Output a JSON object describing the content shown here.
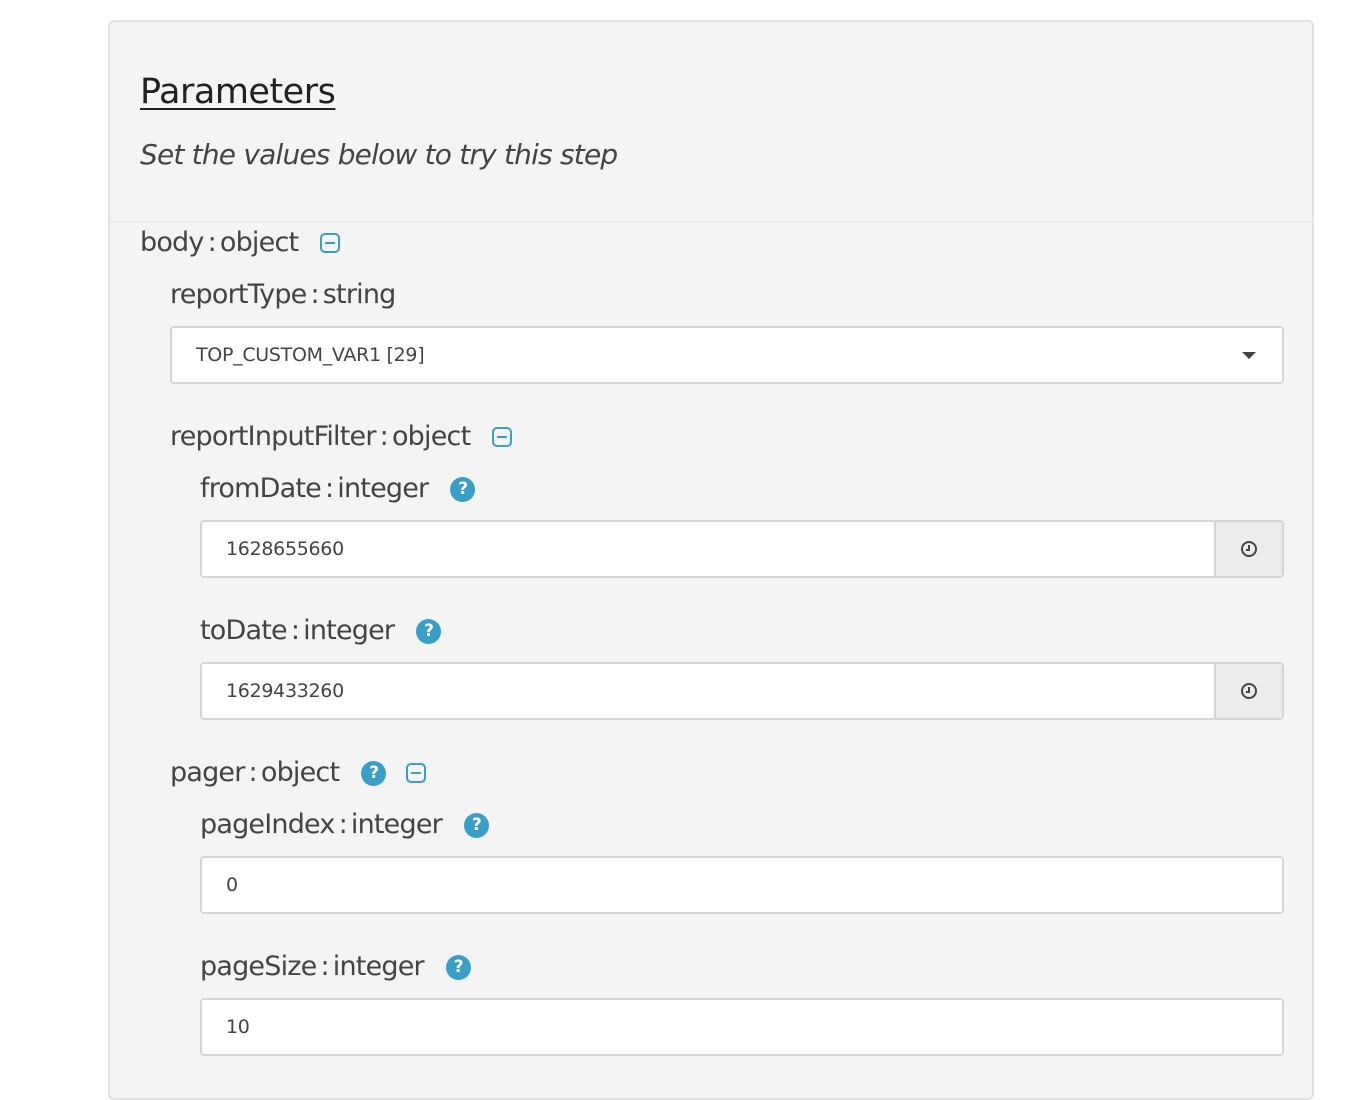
{
  "section": {
    "title": "Parameters",
    "subtitle": "Set the values below to try this step"
  },
  "body": {
    "name": "body",
    "type": "object"
  },
  "reportType": {
    "name": "reportType",
    "type": "string",
    "value": "TOP_CUSTOM_VAR1 [29]"
  },
  "reportInputFilter": {
    "name": "reportInputFilter",
    "type": "object"
  },
  "fromDate": {
    "name": "fromDate",
    "type": "integer",
    "value": "1628655660"
  },
  "toDate": {
    "name": "toDate",
    "type": "integer",
    "value": "1629433260"
  },
  "pager": {
    "name": "pager",
    "type": "object"
  },
  "pageIndex": {
    "name": "pageIndex",
    "type": "integer",
    "value": "0"
  },
  "pageSize": {
    "name": "pageSize",
    "type": "integer",
    "value": "10"
  },
  "common": {
    "separator": ":",
    "help_glyph": "?"
  },
  "colors": {
    "accent": "#3a9fc8",
    "panel_background": "#f4f4f4"
  },
  "icons": {
    "help": "question-circle-icon",
    "collapse": "minus-square-icon",
    "clock": "clock-icon",
    "dropdown": "caret-down-icon"
  }
}
